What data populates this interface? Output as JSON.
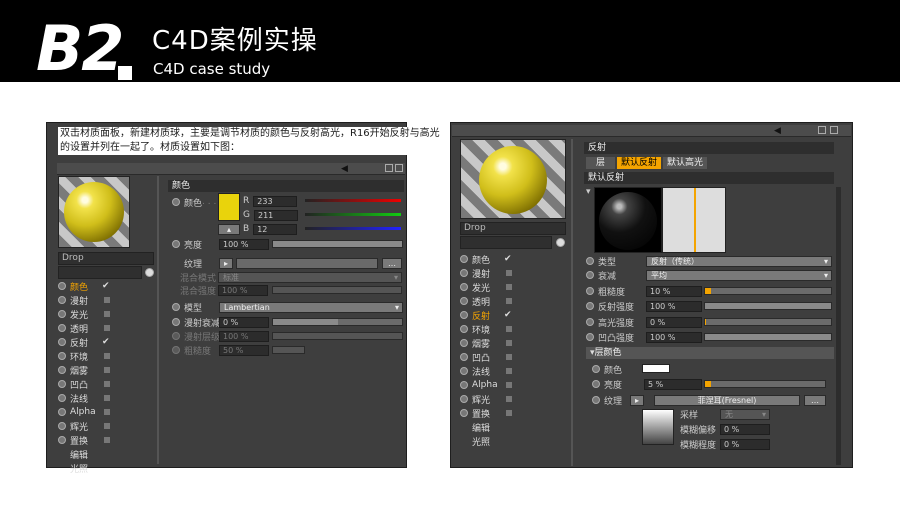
{
  "banner": {
    "code": "B2",
    "title": "C4D案例实操",
    "subtitle": "C4D case study"
  },
  "description": "双击材质面板，新建材质球，主要是调节材质的颜色与反射高光，R16开始反射与高光的设置并列在一起了。材质设置如下图：",
  "material_name": "Drop",
  "channels": [
    {
      "label": "颜色",
      "checked": true
    },
    {
      "label": "漫射",
      "checked": false
    },
    {
      "label": "发光",
      "checked": false
    },
    {
      "label": "透明",
      "checked": false
    },
    {
      "label": "反射",
      "checked": true
    },
    {
      "label": "环境",
      "checked": false
    },
    {
      "label": "烟雾",
      "checked": false
    },
    {
      "label": "凹凸",
      "checked": false
    },
    {
      "label": "法线",
      "checked": false
    },
    {
      "label": "Alpha",
      "checked": false
    },
    {
      "label": "辉光",
      "checked": false
    },
    {
      "label": "置换",
      "checked": false
    }
  ],
  "extra_items": [
    "编辑",
    "光照"
  ],
  "color_panel": {
    "header": "颜色",
    "color_label": "颜色",
    "swatch": "#e9d30c",
    "r_label": "R",
    "r": "233",
    "g_label": "G",
    "g": "211",
    "b_label": "B",
    "b": "12",
    "brightness_label": "亮度",
    "brightness": "100 %",
    "texture_label": "纹理",
    "mix_mode_label": "混合模式",
    "mix_mode": "标准",
    "mix_strength_label": "混合强度",
    "mix_strength": "100 %",
    "model_label": "模型",
    "model": "Lambertian",
    "diffuse_falloff_label": "漫射衰减",
    "diffuse_falloff": "0 %",
    "diffuse_level_label": "漫射层级",
    "diffuse_level": "100 %",
    "roughness_label": "粗糙度",
    "roughness": "50 %"
  },
  "reflect_panel": {
    "header": "反射",
    "tabs": [
      "层",
      "默认反射",
      "默认高光"
    ],
    "subheader": "默认反射",
    "type_label": "类型",
    "type": "反射（传统）",
    "falloff_label": "衰减",
    "falloff": "平均",
    "roughness_label": "粗糙度",
    "roughness": "10 %",
    "refl_strength_label": "反射强度",
    "refl_strength": "100 %",
    "spec_strength_label": "高光强度",
    "spec_strength": "0 %",
    "bump_strength_label": "凹凸强度",
    "bump_strength": "100 %",
    "layer_color_header": "层颜色",
    "lc_color_label": "颜色",
    "lc_swatch": "#ffffff",
    "lc_brightness_label": "亮度",
    "lc_brightness": "5 %",
    "lc_texture_label": "纹理",
    "lc_texture": "菲涅耳(Fresnel)",
    "sample_label": "采样",
    "sample": "无",
    "blur_offset_label": "模糊偏移",
    "blur_offset": "0 %",
    "blur_scale_label": "模糊程度",
    "blur_scale": "0 %"
  },
  "colors": {
    "accent": "#f4a400",
    "panel": "#3e3e3e"
  }
}
